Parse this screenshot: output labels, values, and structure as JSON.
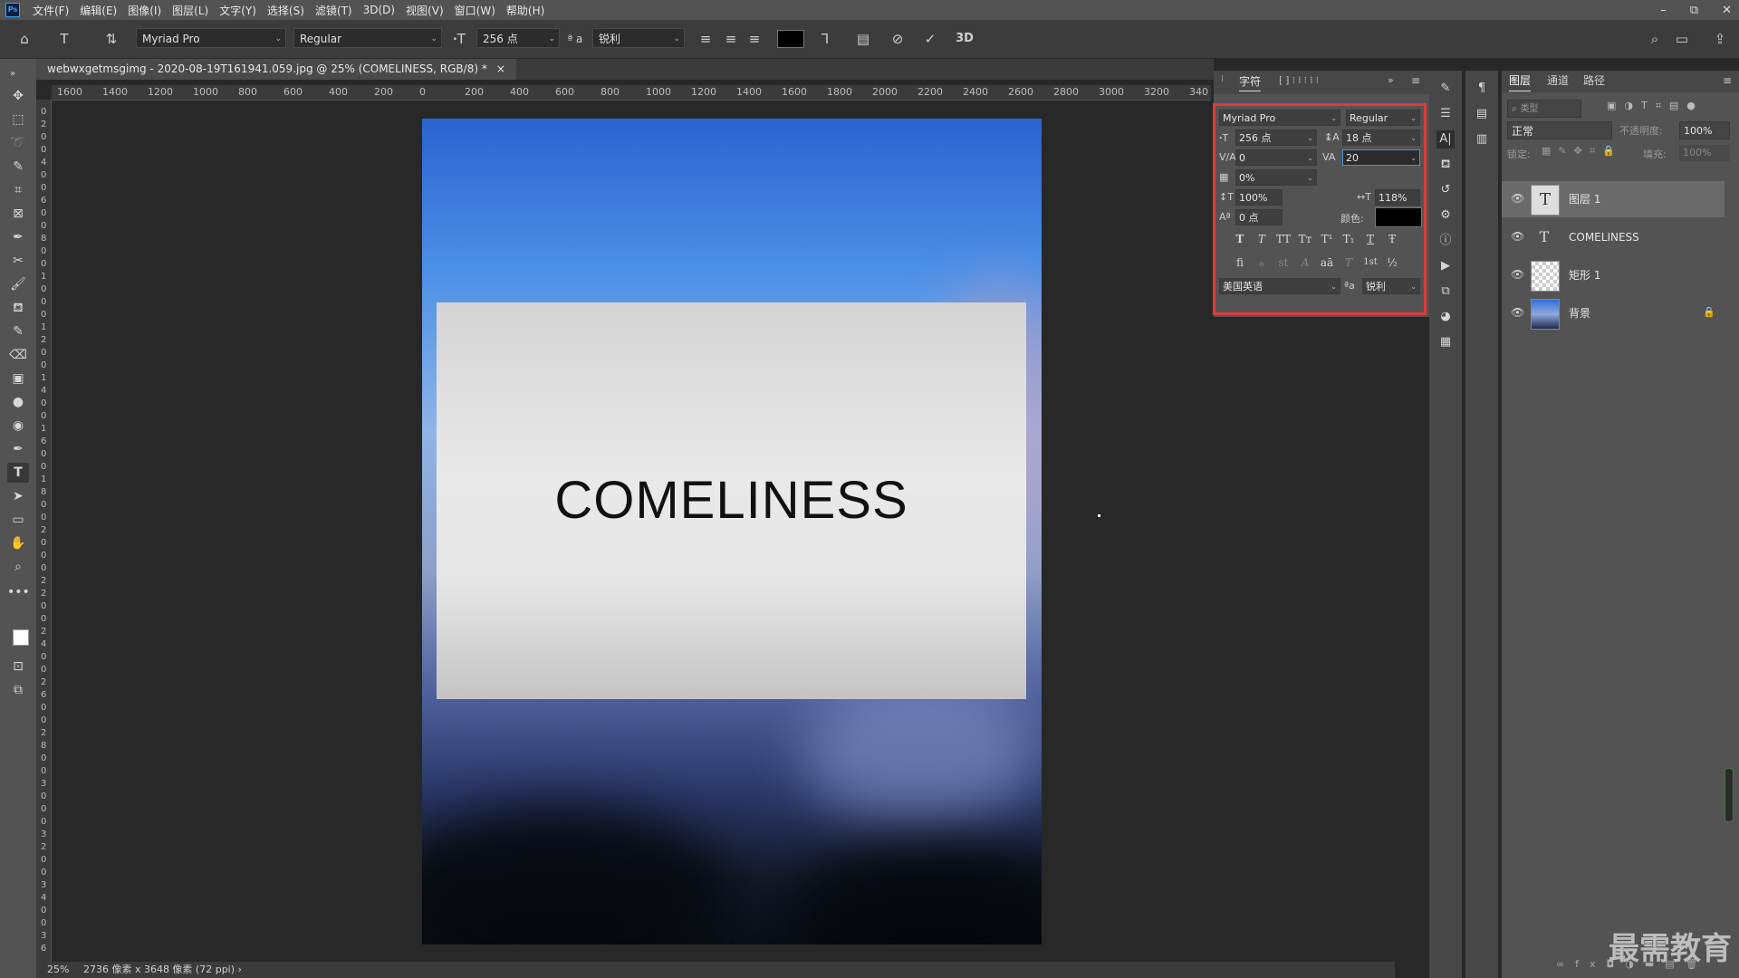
{
  "menubar": {
    "logo": "Ps",
    "items": [
      "文件(F)",
      "编辑(E)",
      "图像(I)",
      "图层(L)",
      "文字(Y)",
      "选择(S)",
      "滤镜(T)",
      "3D(D)",
      "视图(V)",
      "窗口(W)",
      "帮助(H)"
    ],
    "win_min": "–",
    "win_restore": "⧉",
    "win_close": "✕"
  },
  "options": {
    "font_family": "Myriad Pro",
    "font_style": "Regular",
    "font_size": "256 点",
    "antialias_icon": "ª a",
    "antialias": "锐利",
    "threed": "3D"
  },
  "doc": {
    "tab_title": "webwxgetmsgimg - 2020-08-19T161941.059.jpg @ 25% (COMELINESS, RGB/8) *",
    "tab_close": "×",
    "text_layer_content": "COMELINESS"
  },
  "ruler": {
    "h_ticks": [
      "1600",
      "1400",
      "1200",
      "1000",
      "800",
      "600",
      "400",
      "200",
      "0",
      "200",
      "400",
      "600",
      "800",
      "1000",
      "1200",
      "1400",
      "1600",
      "1800",
      "2000",
      "2200",
      "2400",
      "2600",
      "2800",
      "3000",
      "3200",
      "340"
    ],
    "v_ticks": [
      "0",
      "2",
      "0",
      "0",
      "4",
      "0",
      "0",
      "6",
      "0",
      "0",
      "8",
      "0",
      "0",
      "1",
      "0",
      "0",
      "0",
      "1",
      "2",
      "0",
      "0",
      "1",
      "4",
      "0",
      "0",
      "1",
      "6",
      "0",
      "0",
      "1",
      "8",
      "0",
      "0",
      "2",
      "0",
      "0",
      "0",
      "2",
      "2",
      "0",
      "0",
      "2",
      "4",
      "0",
      "0",
      "2",
      "6",
      "0",
      "0",
      "2",
      "8",
      "0",
      "0",
      "3",
      "0",
      "0",
      "0",
      "3",
      "2",
      "0",
      "0",
      "3",
      "4",
      "0",
      "0",
      "3",
      "6"
    ]
  },
  "character_panel": {
    "tab_label": "字符",
    "font_family": "Myriad Pro",
    "font_style": "Regular",
    "font_size": "256 点",
    "leading": "18 点",
    "kerning": "0",
    "tracking": "20",
    "tsume": "0%",
    "vertical_scale": "100%",
    "horizontal_scale": "118%",
    "baseline_shift": "0 点",
    "color_label": "颜色:",
    "type_buttons": [
      "T",
      "T",
      "TT",
      "Tт",
      "T¹",
      "T₁",
      "T",
      "Ŧ"
    ],
    "opentype_buttons": [
      "ﬁ",
      "ℴ",
      "st",
      "A",
      "aā",
      "T",
      "1st",
      "½"
    ],
    "language": "美国英语",
    "antialias": "锐利",
    "antialias_icon": "ªa"
  },
  "layers_panel": {
    "tabs": [
      "图层",
      "通道",
      "路径"
    ],
    "search_placeholder": "类型",
    "blend_mode": "正常",
    "opacity_label": "不透明度:",
    "opacity": "100%",
    "lock_label": "锁定:",
    "fill_label": "填充:",
    "fill": "100%",
    "layers": [
      {
        "name": "图层 1",
        "type": "text",
        "selected": true
      },
      {
        "name": "COMELINESS",
        "type": "text",
        "selected": false
      },
      {
        "name": "矩形 1",
        "type": "shape",
        "selected": false
      },
      {
        "name": "背景",
        "type": "image",
        "selected": false,
        "locked": true
      }
    ]
  },
  "status": {
    "zoom": "25%",
    "info": "2736 像素 x 3648 像素 (72 ppi)",
    "arrow": "›"
  },
  "watermark": "最需教育",
  "colors": {
    "accent_red_box": "#e03a3a",
    "text_color_swatch": "#000000"
  }
}
